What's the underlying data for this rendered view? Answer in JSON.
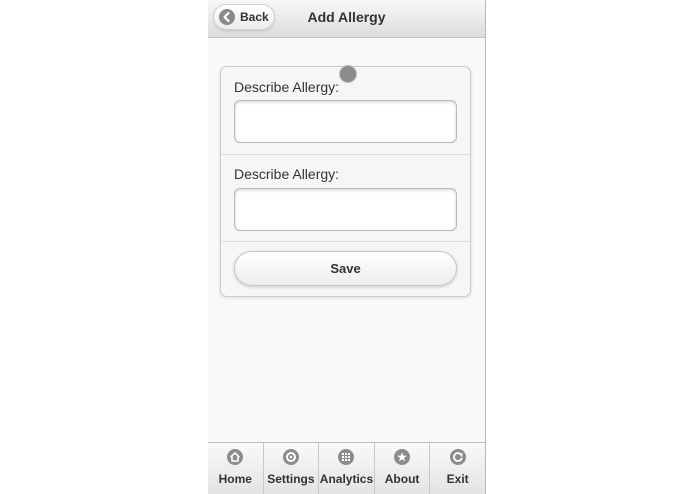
{
  "header": {
    "back_label": "Back",
    "title": "Add Allergy"
  },
  "form": {
    "field1": {
      "label": "Describe Allergy:",
      "value": "",
      "placeholder": ""
    },
    "field2": {
      "label": "Describe Allergy:",
      "value": "",
      "placeholder": ""
    },
    "save_label": "Save"
  },
  "navbar": {
    "items": [
      {
        "label": "Home",
        "icon": "home-icon"
      },
      {
        "label": "Settings",
        "icon": "gear-icon"
      },
      {
        "label": "Analytics",
        "icon": "grid-icon"
      },
      {
        "label": "About",
        "icon": "star-icon"
      },
      {
        "label": "Exit",
        "icon": "power-icon"
      }
    ]
  },
  "colors": {
    "icon_gray": "#8c8c8c",
    "text": "#333333",
    "header_top": "#f8f8f8",
    "header_bottom": "#dcdcdc"
  }
}
